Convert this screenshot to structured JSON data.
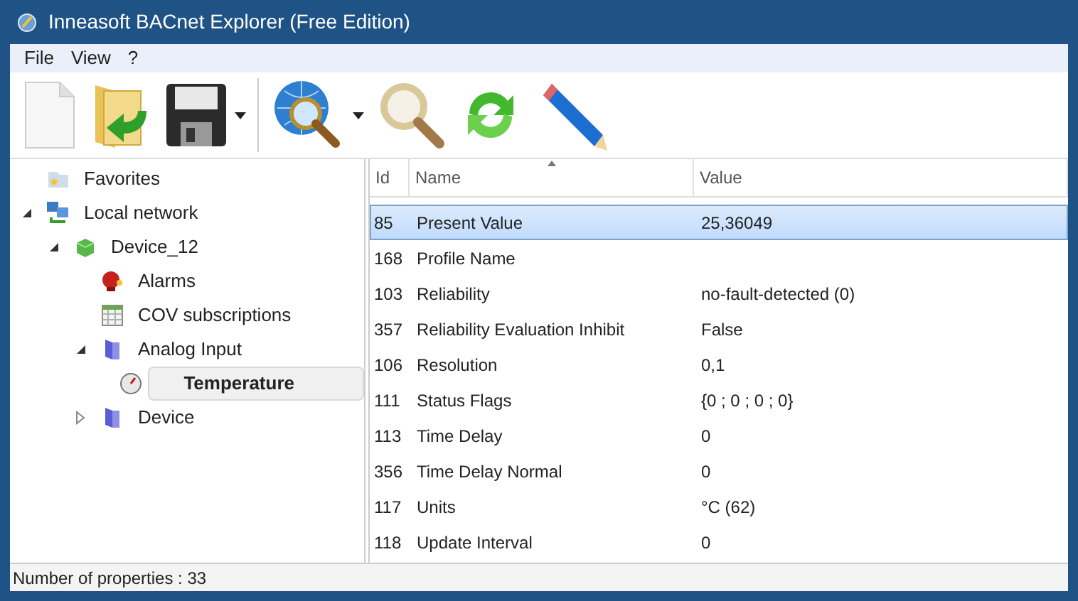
{
  "window": {
    "title": "Inneasoft BACnet Explorer (Free Edition)"
  },
  "menu": [
    {
      "label": "File"
    },
    {
      "label": "View"
    },
    {
      "label": "?"
    }
  ],
  "toolbar": [
    {
      "kind": "new",
      "dropdown": false
    },
    {
      "kind": "open",
      "dropdown": false
    },
    {
      "kind": "save",
      "dropdown": true
    },
    {
      "kind": "discover",
      "dropdown": true
    },
    {
      "kind": "search",
      "dropdown": false
    },
    {
      "kind": "refresh",
      "dropdown": false
    },
    {
      "kind": "edit",
      "dropdown": false
    }
  ],
  "tree": [
    {
      "label": "Favorites",
      "kind": "favorites",
      "selected": false
    },
    {
      "label": "Local network",
      "kind": "network",
      "selected": false,
      "expanded": true,
      "children": [
        {
          "label": "Device_12",
          "kind": "device",
          "selected": false,
          "expanded": true,
          "children": [
            {
              "label": "Alarms",
              "kind": "alarm",
              "selected": false
            },
            {
              "label": "COV subscriptions",
              "kind": "table",
              "selected": false
            },
            {
              "label": "Analog Input",
              "kind": "folder",
              "selected": false,
              "expanded": true,
              "children": [
                {
                  "label": "Temperature",
                  "kind": "gauge",
                  "selected": true
                }
              ]
            },
            {
              "label": "Device",
              "kind": "folder",
              "selected": false,
              "expanded": false
            }
          ]
        }
      ]
    }
  ],
  "table": {
    "columns": [
      {
        "label": "Id",
        "sorted": false
      },
      {
        "label": "Name",
        "sorted": true
      },
      {
        "label": "Value",
        "sorted": false
      }
    ],
    "rows": [
      {
        "id": "85",
        "name": "Present Value",
        "value": "25,36049",
        "selected": true
      },
      {
        "id": "168",
        "name": "Profile Name",
        "selected": false
      },
      {
        "id": "103",
        "name": "Reliability",
        "value": "no-fault-detected (0)",
        "selected": false
      },
      {
        "id": "357",
        "name": "Reliability Evaluation Inhibit",
        "value": "False",
        "selected": false
      },
      {
        "id": "106",
        "name": "Resolution",
        "value": "0,1",
        "selected": false
      },
      {
        "id": "111",
        "name": "Status Flags",
        "value": "{0 ; 0 ; 0 ; 0}",
        "selected": false
      },
      {
        "id": "113",
        "name": "Time Delay",
        "value": "0",
        "selected": false
      },
      {
        "id": "356",
        "name": "Time Delay Normal",
        "value": "0",
        "selected": false
      },
      {
        "id": "117",
        "name": "Units",
        "value": "°C (62)",
        "selected": false
      },
      {
        "id": "118",
        "name": "Update Interval",
        "value": "0",
        "selected": false
      }
    ]
  },
  "status_bar": "Number of properties : 33"
}
